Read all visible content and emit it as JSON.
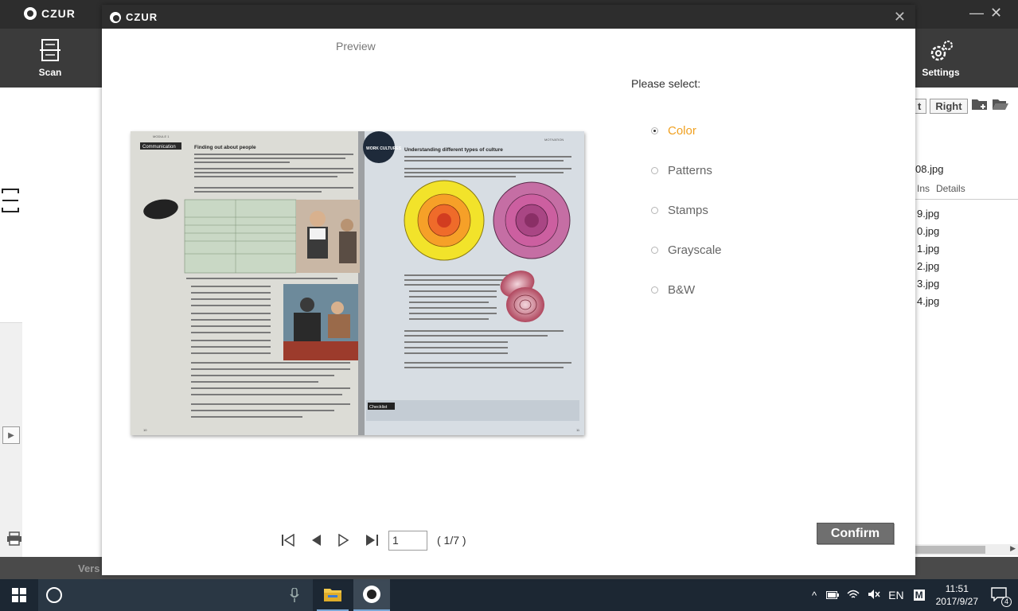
{
  "app": {
    "brand": "CZUR",
    "toolbar": {
      "scan": "Scan",
      "settings": "Settings"
    },
    "rotate_buttons": {
      "left_partial": "t",
      "right": "Right"
    },
    "file_partial": "08.jpg",
    "file_tabs": {
      "ins": "Ins",
      "details": "Details"
    },
    "files": [
      "9.jpg",
      "0.jpg",
      "1.jpg",
      "2.jpg",
      "3.jpg",
      "4.jpg"
    ],
    "status_partial": "Vers"
  },
  "dialog": {
    "brand": "CZUR",
    "preview_label": "Preview",
    "select_label": "Please select:",
    "options": [
      {
        "label": "Color",
        "selected": true
      },
      {
        "label": "Patterns",
        "selected": false
      },
      {
        "label": "Stamps",
        "selected": false
      },
      {
        "label": "Grayscale",
        "selected": false
      },
      {
        "label": "B&W",
        "selected": false
      }
    ],
    "selected_color": "#f0a020",
    "page_input": "1",
    "page_total": "( 1/7 )",
    "confirm_label": "Confirm"
  },
  "taskbar": {
    "lang": "EN",
    "ime": "M",
    "time": "11:51",
    "date": "2017/9/27",
    "notifications": "4"
  },
  "book": {
    "left_module": "MODULE 1",
    "left_heading_tag": "Communication",
    "left_title": "Finding out about people",
    "right_title": "Understanding different types of culture",
    "right_tag": "MOTIVATION",
    "badge": "WORK CULTURES",
    "checklist": "Checklist",
    "left_page_num": "10",
    "right_page_num": "11"
  }
}
